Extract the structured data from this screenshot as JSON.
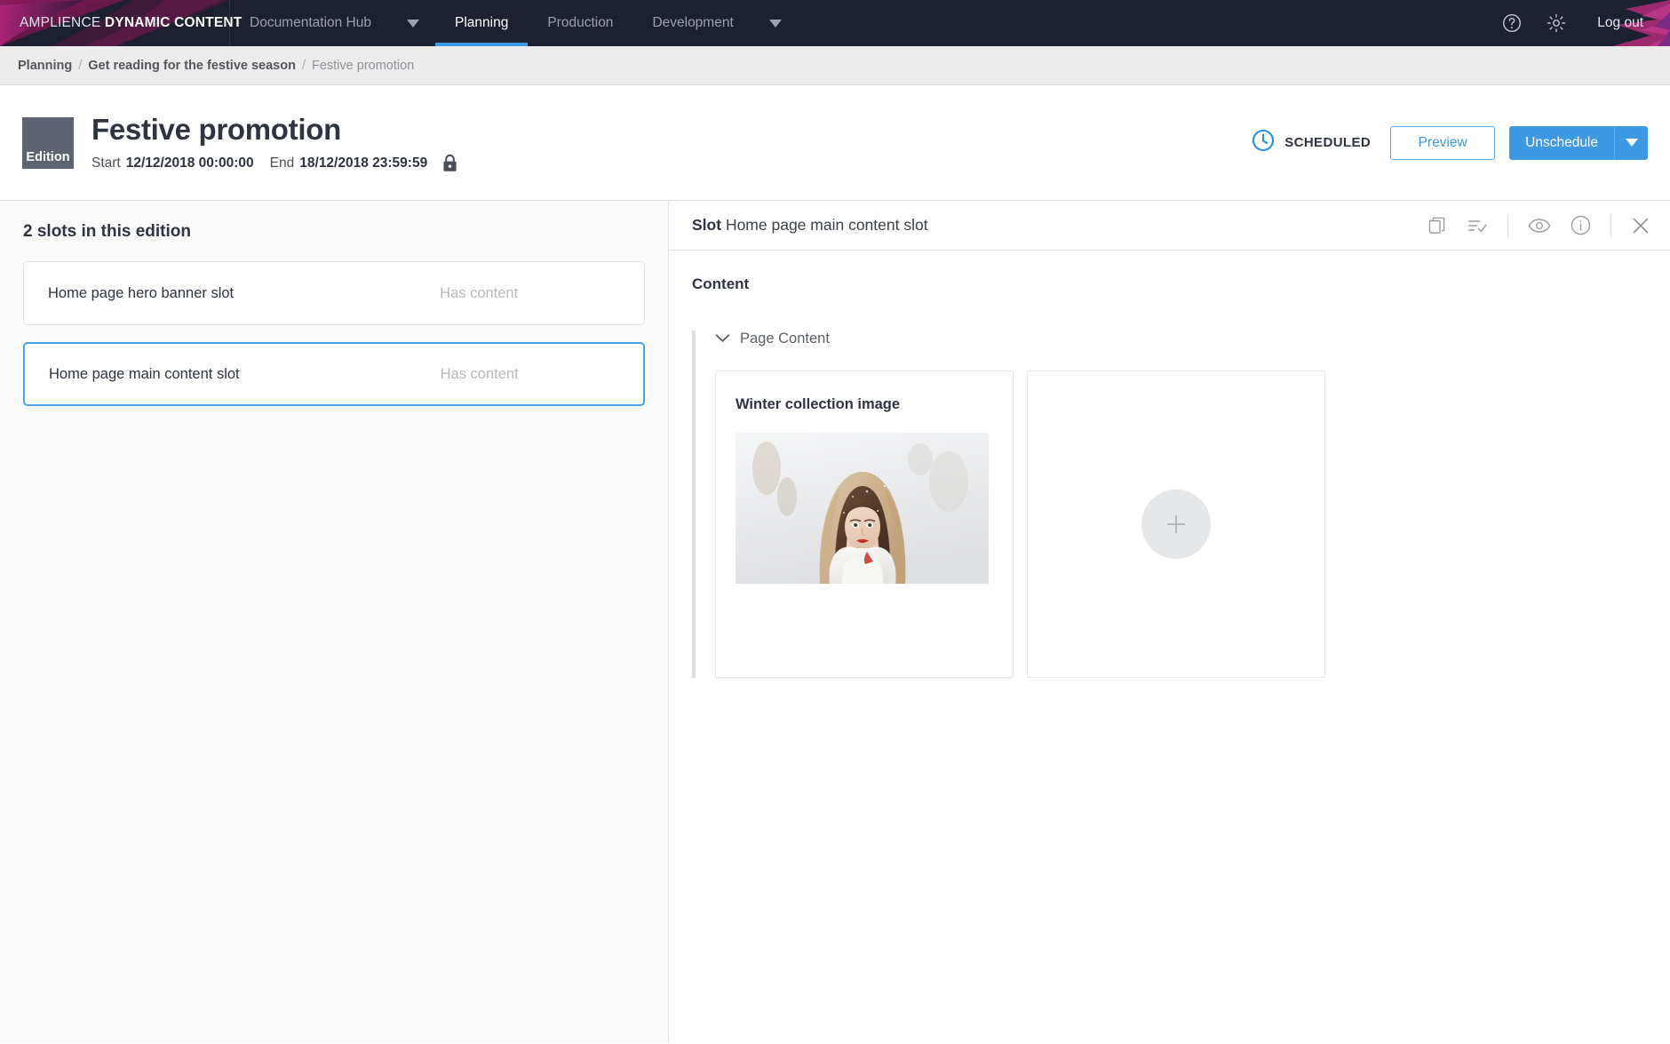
{
  "topnav": {
    "logo_thin": "AMPLIENCE",
    "logo_bold": "DYNAMIC CONTENT",
    "items": [
      {
        "label": "Documentation Hub",
        "active": false,
        "has_caret": true
      },
      {
        "label": "Planning",
        "active": true,
        "has_caret": false
      },
      {
        "label": "Production",
        "active": false,
        "has_caret": false
      },
      {
        "label": "Development",
        "active": false,
        "has_caret": true
      }
    ],
    "help_icon": "help-circle-icon",
    "settings_icon": "gear-icon",
    "logout_label": "Log out",
    "active_underline_color": "#3d9ae2",
    "background_color": "#1c2030"
  },
  "breadcrumb": {
    "items": [
      {
        "label": "Planning"
      },
      {
        "label": "Get reading for the festive season"
      },
      {
        "label": "Festive promotion"
      }
    ],
    "separator": "/"
  },
  "header": {
    "badge_label": "Edition",
    "title": "Festive promotion",
    "start_label": "Start",
    "start_value": "12/12/2018 00:00:00",
    "end_label": "End",
    "end_value": "18/12/2018 23:59:59",
    "lock_icon": "lock-icon",
    "status_icon": "clock-icon",
    "status_label": "SCHEDULED",
    "status_color": "#2a8fd4",
    "preview_label": "Preview",
    "unschedule_label": "Unschedule",
    "unschedule_caret_icon": "chevron-down-icon",
    "accent_color": "#3d9ae2"
  },
  "left_panel": {
    "heading": "2 slots in this edition",
    "slots": [
      {
        "name": "Home page hero banner slot",
        "status": "Has content",
        "selected": false
      },
      {
        "name": "Home page main content slot",
        "status": "Has content",
        "selected": true
      }
    ],
    "selected_border_color": "#4ba3e3"
  },
  "right_panel": {
    "slot_label": "Slot",
    "slot_name": "Home page main content slot",
    "tools": [
      {
        "name": "copy-icon"
      },
      {
        "name": "list-check-icon"
      },
      {
        "name": "eye-icon"
      },
      {
        "name": "info-icon"
      },
      {
        "name": "close-icon"
      }
    ],
    "content_heading": "Content",
    "group": {
      "toggle_icon": "chevron-down-icon",
      "title": "Page Content",
      "cards": [
        {
          "title": "Winter collection image",
          "thumbnail": "winter-portrait-snow-photo"
        }
      ],
      "add_card_icon": "plus-icon"
    }
  }
}
